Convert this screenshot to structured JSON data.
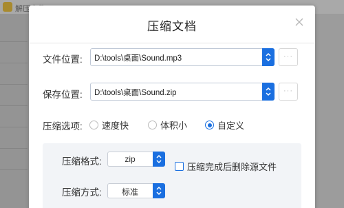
{
  "background": {
    "app_title": "解压文件"
  },
  "dialog": {
    "title": "压缩文档",
    "close_icon": "close-icon",
    "file_location": {
      "label": "文件位置:",
      "value": "D:\\tools\\桌面\\Sound.mp3",
      "more_label": "···"
    },
    "save_location": {
      "label": "保存位置:",
      "value": "D:\\tools\\桌面\\Sound.zip",
      "more_label": "···"
    },
    "compress_options": {
      "label": "压缩选项:",
      "options": [
        "速度快",
        "体积小",
        "自定义"
      ],
      "selected": "自定义"
    },
    "format": {
      "label": "压缩格式:",
      "value": "zip"
    },
    "delete_source": {
      "label": "压缩完成后删除源文件",
      "checked": false
    },
    "method": {
      "label": "压缩方式:",
      "value": "标准"
    }
  },
  "colors": {
    "accent": "#1a6fe0",
    "panel_bg": "#f2f4f7",
    "overlay": "#9c9c9c"
  }
}
